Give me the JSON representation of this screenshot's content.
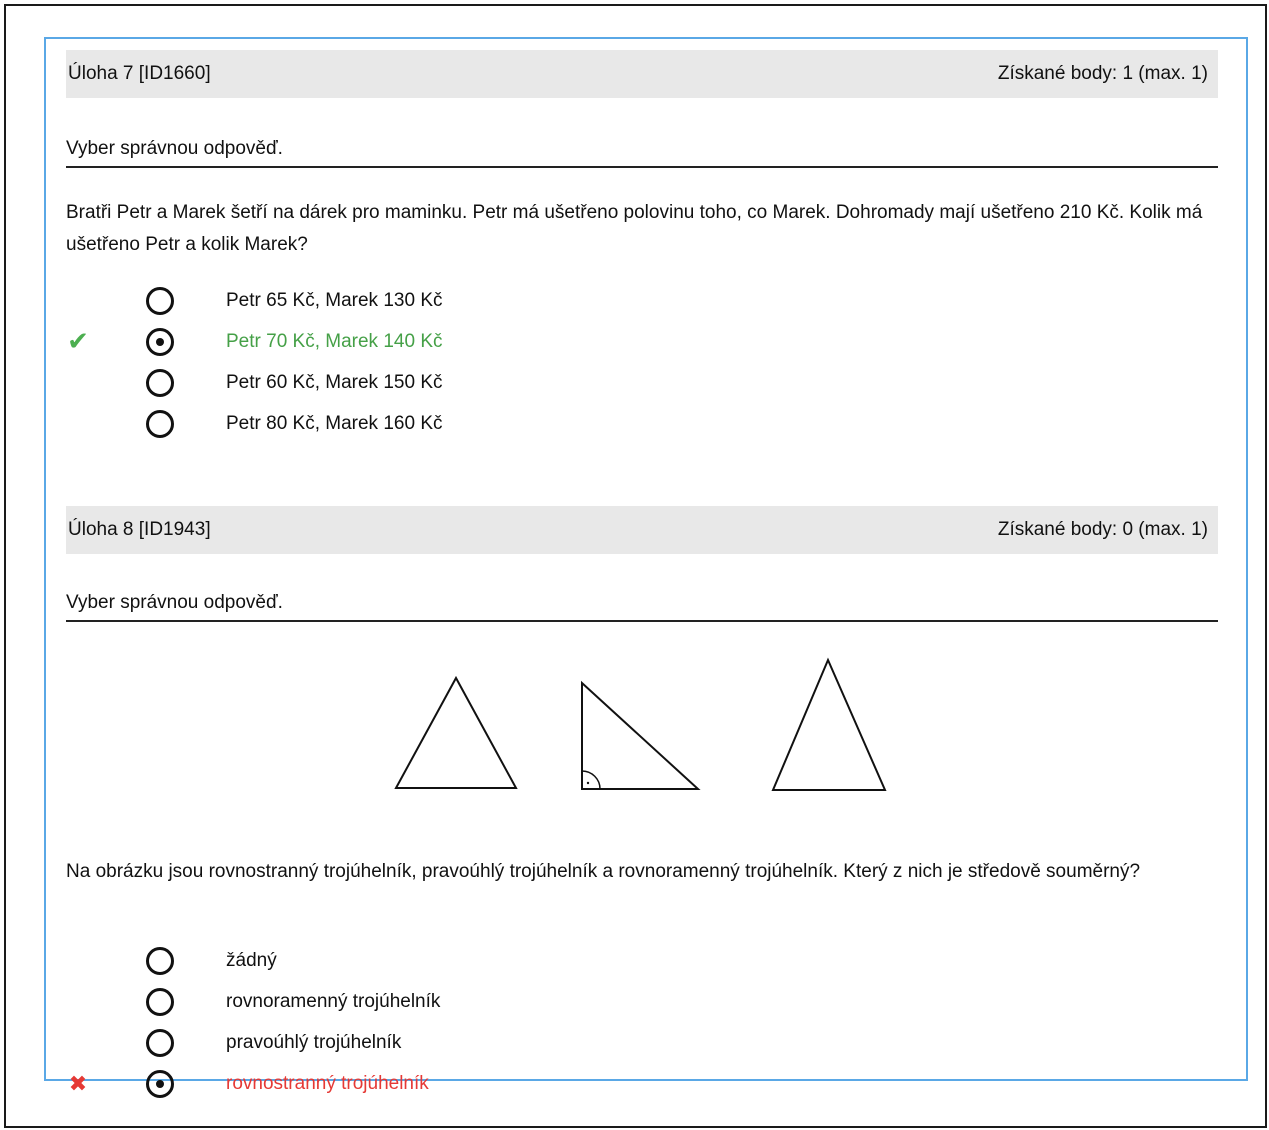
{
  "tasks": [
    {
      "title": "Úloha 7 [ID1660]",
      "score": "Získané body: 1 (max. 1)",
      "instruction": "Vyber správnou odpověď.",
      "question": "Bratři Petr a Marek šetří na dárek pro maminku. Petr má ušetřeno polovinu toho, co Marek. Dohromady mají ušetřeno 210 Kč. Kolik má ušetřeno Petr a kolik Marek?",
      "answers": [
        {
          "label": "Petr 65 Kč, Marek 130 Kč",
          "selected": false,
          "status": "none"
        },
        {
          "label": "Petr 70 Kč, Marek 140 Kč",
          "selected": true,
          "status": "correct",
          "mark": "✔"
        },
        {
          "label": "Petr 60 Kč, Marek 150 Kč",
          "selected": false,
          "status": "none"
        },
        {
          "label": "Petr 80 Kč, Marek 160 Kč",
          "selected": false,
          "status": "none"
        }
      ]
    },
    {
      "title": "Úloha 8 [ID1943]",
      "score": "Získané body: 0 (max. 1)",
      "instruction": "Vyber správnou odpověď.",
      "question": "Na obrázku jsou rovnostranný trojúhelník, pravoúhlý trojúhelník a rovnoramenný trojúhelník. Který z nich je středově souměrný?",
      "answers": [
        {
          "label": "žádný",
          "selected": false,
          "status": "none"
        },
        {
          "label": "rovnoramenný trojúhelník",
          "selected": false,
          "status": "none"
        },
        {
          "label": "pravoúhlý trojúhelník",
          "selected": false,
          "status": "none"
        },
        {
          "label": "rovnostranný trojúhelník",
          "selected": true,
          "status": "wrong",
          "mark": "✖"
        }
      ]
    }
  ],
  "colors": {
    "correct": "#45a047",
    "wrong": "#e53935",
    "header_bg": "#e8e8e8",
    "panel_border": "#5aa8e6"
  }
}
